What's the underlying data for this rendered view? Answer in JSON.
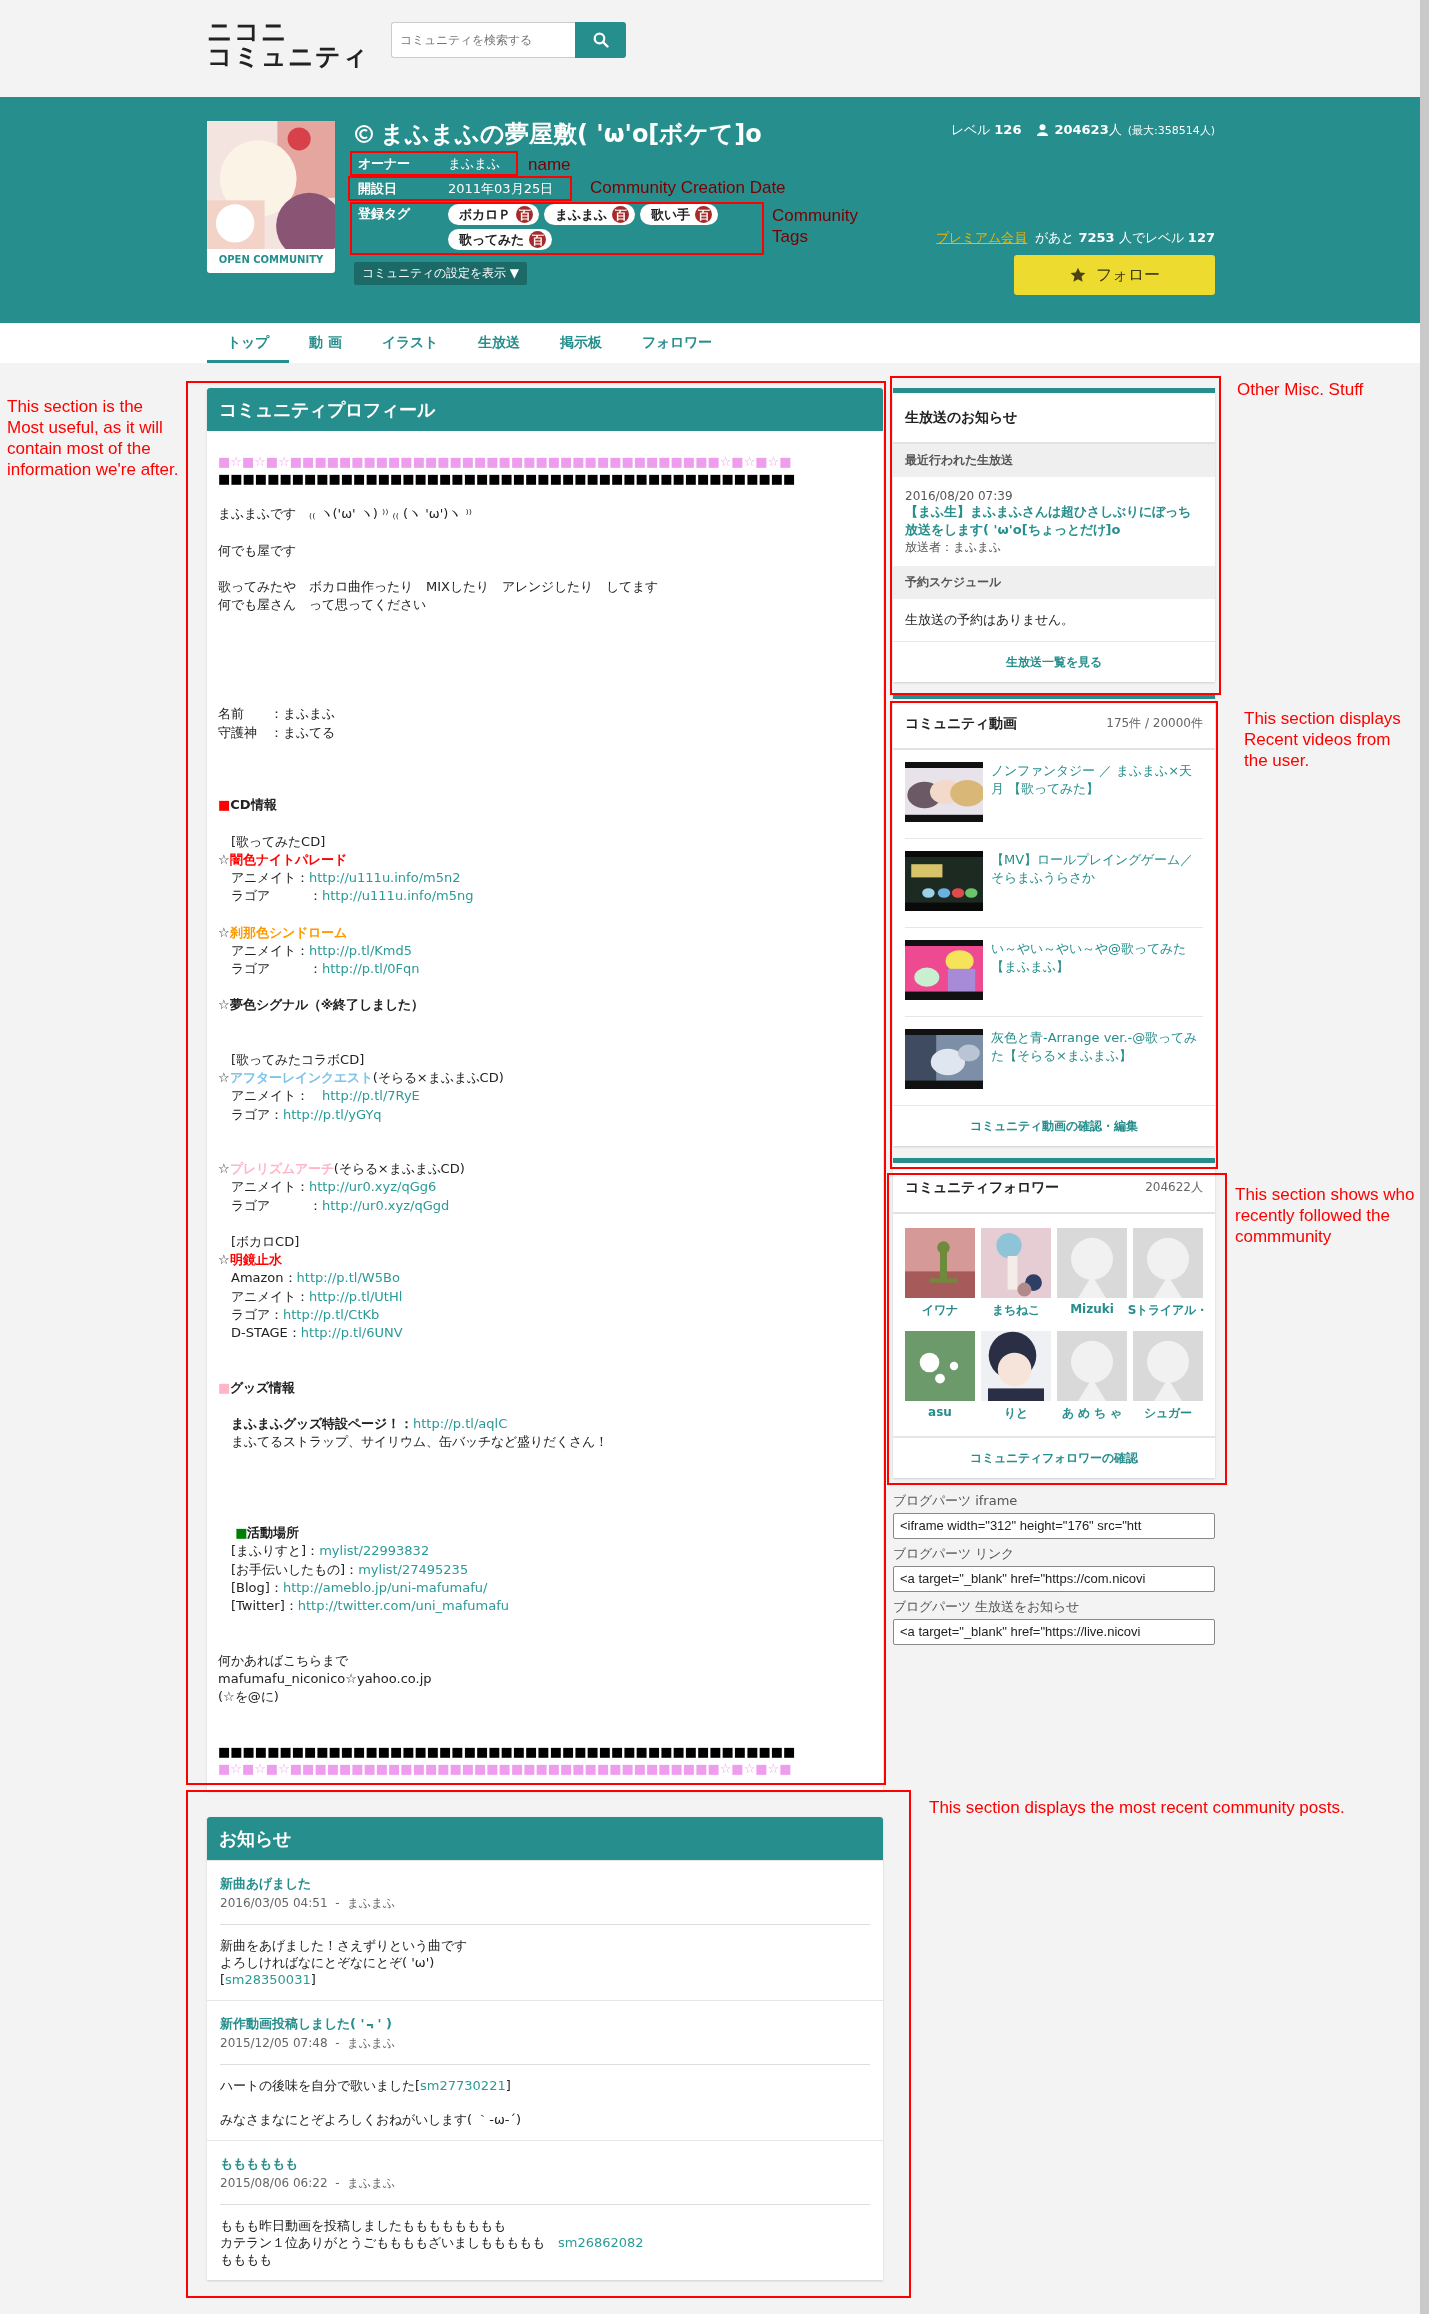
{
  "header": {
    "logo": [
      "ニコニ",
      "コミュニティ"
    ],
    "search": {
      "placeholder": "コミュニティを検索する"
    }
  },
  "community": {
    "title": "まふまふの夢屋敷( 'ω'o[ボケて]o",
    "avatar_label": "OPEN COMMUNITY",
    "info": [
      {
        "kind": "text",
        "label": "オーナー",
        "value": "まふまふ"
      },
      {
        "kind": "text",
        "label": "開設日",
        "value": "2011年03月25日"
      },
      {
        "kind": "tags",
        "label": "登録タグ",
        "tags": [
          {
            "name": "ボカロＰ",
            "badge": "百"
          },
          {
            "name": "まふまふ",
            "badge": "百"
          },
          {
            "name": "歌い手",
            "badge": "百"
          },
          {
            "name": "歌ってみた",
            "badge": "百"
          }
        ]
      }
    ],
    "settings_button": "コミュニティの設定を表示 ▼",
    "level": "レベル **126**",
    "members": "**204623**人",
    "members_max": "(最大:358514人)",
    "premium_link": "プレミアム会員",
    "premium_text": "があと **7253** 人でレベル **127**",
    "follow_button": "フォロー"
  },
  "tabs": [
    {
      "label": "トップ",
      "selected": true
    },
    {
      "label": "動 画",
      "selected": false
    },
    {
      "label": "イラスト",
      "selected": false
    },
    {
      "label": "生放送",
      "selected": false
    },
    {
      "label": "掲示板",
      "selected": false
    },
    {
      "label": "フォロワー",
      "selected": false
    }
  ],
  "profile": {
    "title": "コミュニティプロフィール",
    "lines": [
      {
        "kind": "bar",
        "text": "■☆■☆■☆■■■■■■■■■■■■■■■■■■■■■■■■■■■■■■■■■■■☆■☆■☆■",
        "color": "#ee9cee"
      },
      {
        "kind": "bar",
        "text": "■■■■■■■■■■■■■■■■■■■■■■■■■■■■■■■■■■■■■■■■■■■■■■■",
        "color": "#000000"
      },
      {
        "kind": "blank"
      },
      {
        "kind": "line",
        "parts": [
          {
            "kind": "text",
            "text": "まふまふです　₍₍ ヽ('ω' ヽ) ⁾⁾ ₍₍ (ヽ 'ω')ヽ ⁾⁾"
          }
        ]
      },
      {
        "kind": "blank"
      },
      {
        "kind": "line",
        "parts": [
          {
            "kind": "text",
            "text": "何でも屋です"
          }
        ]
      },
      {
        "kind": "blank"
      },
      {
        "kind": "line",
        "parts": [
          {
            "kind": "text",
            "text": "歌ってみたや　ボカロ曲作ったり　MIXしたり　アレンジしたり　してます"
          }
        ]
      },
      {
        "kind": "line",
        "parts": [
          {
            "kind": "text",
            "text": "何でも屋さん　って思ってください"
          }
        ]
      },
      {
        "kind": "blank"
      },
      {
        "kind": "blank"
      },
      {
        "kind": "blank"
      },
      {
        "kind": "blank"
      },
      {
        "kind": "blank"
      },
      {
        "kind": "line",
        "parts": [
          {
            "kind": "text",
            "text": "名前　　：まふまふ"
          }
        ]
      },
      {
        "kind": "line",
        "parts": [
          {
            "kind": "text",
            "text": "守護神　：まふてる"
          }
        ]
      },
      {
        "kind": "blank"
      },
      {
        "kind": "blank"
      },
      {
        "kind": "blank"
      },
      {
        "kind": "line",
        "parts": [
          {
            "kind": "mark",
            "text": "■",
            "color": "#ff0000"
          },
          {
            "kind": "strong",
            "text": "CD情報"
          }
        ]
      },
      {
        "kind": "blank"
      },
      {
        "kind": "line",
        "parts": [
          {
            "kind": "text",
            "text": "　[歌ってみたCD]"
          }
        ]
      },
      {
        "kind": "line",
        "parts": [
          {
            "kind": "text",
            "text": "☆"
          },
          {
            "kind": "title",
            "text": "闇色ナイトパレード",
            "color": "#ff0000"
          }
        ]
      },
      {
        "kind": "line",
        "parts": [
          {
            "kind": "text",
            "text": "　アニメイト："
          },
          {
            "kind": "link",
            "text": "http://u111u.info/m5n2"
          }
        ]
      },
      {
        "kind": "line",
        "parts": [
          {
            "kind": "text",
            "text": "　ラゴア　　　："
          },
          {
            "kind": "link",
            "text": "http://u111u.info/m5ng"
          }
        ]
      },
      {
        "kind": "blank"
      },
      {
        "kind": "line",
        "parts": [
          {
            "kind": "text",
            "text": "☆"
          },
          {
            "kind": "title",
            "text": "刹那色シンドローム",
            "color": "#ff9900"
          }
        ]
      },
      {
        "kind": "line",
        "parts": [
          {
            "kind": "text",
            "text": "　アニメイト："
          },
          {
            "kind": "link",
            "text": "http://p.tl/Kmd5"
          }
        ]
      },
      {
        "kind": "line",
        "parts": [
          {
            "kind": "text",
            "text": "　ラゴア　　　："
          },
          {
            "kind": "link",
            "text": "http://p.tl/0Fqn"
          }
        ]
      },
      {
        "kind": "blank"
      },
      {
        "kind": "line",
        "parts": [
          {
            "kind": "strong",
            "text": "☆夢色シグナル（※終了しました）"
          }
        ]
      },
      {
        "kind": "blank"
      },
      {
        "kind": "blank"
      },
      {
        "kind": "line",
        "parts": [
          {
            "kind": "text",
            "text": "　[歌ってみたコラボCD]"
          }
        ]
      },
      {
        "kind": "line",
        "parts": [
          {
            "kind": "text",
            "text": "☆"
          },
          {
            "kind": "title",
            "text": "アフターレインクエスト",
            "color": "#7ec4e6"
          },
          {
            "kind": "text",
            "text": "(そらる×まふまふCD)"
          }
        ]
      },
      {
        "kind": "line",
        "parts": [
          {
            "kind": "text",
            "text": "　アニメイト：　"
          },
          {
            "kind": "link",
            "text": "http://p.tl/7RyE"
          }
        ]
      },
      {
        "kind": "line",
        "parts": [
          {
            "kind": "text",
            "text": "　ラゴア："
          },
          {
            "kind": "link",
            "text": "http://p.tl/yGYq"
          }
        ]
      },
      {
        "kind": "blank"
      },
      {
        "kind": "blank"
      },
      {
        "kind": "line",
        "parts": [
          {
            "kind": "text",
            "text": "☆"
          },
          {
            "kind": "title",
            "text": "プレリズムアーチ",
            "color": "#ffb6c8"
          },
          {
            "kind": "text",
            "text": "(そらる×まふまふCD)"
          }
        ]
      },
      {
        "kind": "line",
        "parts": [
          {
            "kind": "text",
            "text": "　アニメイト："
          },
          {
            "kind": "link",
            "text": "http://ur0.xyz/qGg6"
          }
        ]
      },
      {
        "kind": "line",
        "parts": [
          {
            "kind": "text",
            "text": "　ラゴア　　　："
          },
          {
            "kind": "link",
            "text": "http://ur0.xyz/qGgd"
          }
        ]
      },
      {
        "kind": "blank"
      },
      {
        "kind": "line",
        "parts": [
          {
            "kind": "text",
            "text": "　[ボカロCD]"
          }
        ]
      },
      {
        "kind": "line",
        "parts": [
          {
            "kind": "text",
            "text": "☆"
          },
          {
            "kind": "title",
            "text": "明鏡止水",
            "color": "#ff0000"
          }
        ]
      },
      {
        "kind": "line",
        "parts": [
          {
            "kind": "text",
            "text": "　Amazon："
          },
          {
            "kind": "link",
            "text": "http://p.tl/W5Bo"
          }
        ]
      },
      {
        "kind": "line",
        "parts": [
          {
            "kind": "text",
            "text": "　アニメイト："
          },
          {
            "kind": "link",
            "text": "http://p.tl/UtHl"
          }
        ]
      },
      {
        "kind": "line",
        "parts": [
          {
            "kind": "text",
            "text": "　ラゴア："
          },
          {
            "kind": "link",
            "text": "http://p.tl/CtKb"
          }
        ]
      },
      {
        "kind": "line",
        "parts": [
          {
            "kind": "text",
            "text": "　D-STAGE："
          },
          {
            "kind": "link",
            "text": "http://p.tl/6UNV"
          }
        ]
      },
      {
        "kind": "blank"
      },
      {
        "kind": "blank"
      },
      {
        "kind": "line",
        "parts": [
          {
            "kind": "mark",
            "text": "■",
            "color": "#ffb6c8"
          },
          {
            "kind": "strong",
            "text": "グッズ情報"
          }
        ]
      },
      {
        "kind": "blank"
      },
      {
        "kind": "line",
        "parts": [
          {
            "kind": "strong",
            "text": "　まふまふグッズ特設ページ！："
          },
          {
            "kind": "link",
            "text": "http://p.tl/aqlC"
          }
        ]
      },
      {
        "kind": "line",
        "parts": [
          {
            "kind": "text",
            "text": "　まふてるストラップ、サイリウム、缶バッチなど盛りだくさん！"
          }
        ]
      },
      {
        "kind": "blank"
      },
      {
        "kind": "blank"
      },
      {
        "kind": "blank"
      },
      {
        "kind": "blank"
      },
      {
        "kind": "line",
        "parts": [
          {
            "kind": "mark",
            "text": "　 ■",
            "color": "#008000"
          },
          {
            "kind": "strong",
            "text": "活動場所"
          }
        ]
      },
      {
        "kind": "line",
        "parts": [
          {
            "kind": "text",
            "text": "　[まふりすと]："
          },
          {
            "kind": "link",
            "text": "mylist/22993832"
          }
        ]
      },
      {
        "kind": "line",
        "parts": [
          {
            "kind": "text",
            "text": "　[お手伝いしたもの]："
          },
          {
            "kind": "link",
            "text": "mylist/27495235"
          }
        ]
      },
      {
        "kind": "line",
        "parts": [
          {
            "kind": "text",
            "text": "　[Blog]："
          },
          {
            "kind": "link",
            "text": "http://ameblo.jp/uni-mafumafu/"
          }
        ]
      },
      {
        "kind": "line",
        "parts": [
          {
            "kind": "text",
            "text": "　[Twitter]："
          },
          {
            "kind": "link",
            "text": "http://twitter.com/uni_mafumafu"
          }
        ]
      },
      {
        "kind": "blank"
      },
      {
        "kind": "blank"
      },
      {
        "kind": "line",
        "parts": [
          {
            "kind": "text",
            "text": "何かあればこちらまで"
          }
        ]
      },
      {
        "kind": "line",
        "parts": [
          {
            "kind": "text",
            "text": "mafumafu_niconico☆yahoo.co.jp"
          }
        ]
      },
      {
        "kind": "line",
        "parts": [
          {
            "kind": "text",
            "text": "(☆を@に)"
          }
        ]
      },
      {
        "kind": "blank"
      },
      {
        "kind": "blank"
      },
      {
        "kind": "bar",
        "text": "■■■■■■■■■■■■■■■■■■■■■■■■■■■■■■■■■■■■■■■■■■■■■■■",
        "color": "#000000"
      },
      {
        "kind": "bar",
        "text": "■☆■☆■☆■■■■■■■■■■■■■■■■■■■■■■■■■■■■■■■■■■■☆■☆■☆■",
        "color": "#ee9cee"
      }
    ]
  },
  "notices": {
    "title": "お知らせ",
    "posts": [
      {
        "title": "新曲あげました",
        "meta": "2016/03/05 04:51  -  まふまふ",
        "lines": [
          {
            "kind": "line",
            "parts": [
              {
                "kind": "text",
                "text": "新曲をあげました！さえずりという曲です"
              }
            ]
          },
          {
            "kind": "line",
            "parts": [
              {
                "kind": "text",
                "text": "よろしければなにとぞなにとぞ( 'ω')"
              }
            ]
          },
          {
            "kind": "line",
            "parts": [
              {
                "kind": "text",
                "text": "["
              },
              {
                "kind": "link",
                "text": "sm28350031"
              },
              {
                "kind": "text",
                "text": "]"
              }
            ]
          }
        ]
      },
      {
        "title": "新作動画投稿しました( '﹃' )",
        "meta": "2015/12/05 07:48  -  まふまふ",
        "lines": [
          {
            "kind": "line",
            "parts": [
              {
                "kind": "text",
                "text": "ハートの後味を自分で歌いました["
              },
              {
                "kind": "link",
                "text": "sm27730221"
              },
              {
                "kind": "text",
                "text": "]"
              }
            ]
          },
          {
            "kind": "blank"
          },
          {
            "kind": "line",
            "parts": [
              {
                "kind": "text",
                "text": "みなさまなにとぞよろしくおねがいします( ｀-ω-´)"
              }
            ]
          }
        ]
      },
      {
        "title": "もももももも",
        "meta": "2015/08/06 06:22  -  まふまふ",
        "lines": [
          {
            "kind": "line",
            "parts": [
              {
                "kind": "text",
                "text": "ももも昨日動画を投稿しましたもももももももも"
              }
            ]
          },
          {
            "kind": "line",
            "parts": [
              {
                "kind": "text",
                "text": "カテラン１位ありがとうごももももざいましももももも　"
              },
              {
                "kind": "link",
                "text": "sm26862082"
              }
            ]
          },
          {
            "kind": "line",
            "parts": [
              {
                "kind": "text",
                "text": "もももも"
              }
            ]
          }
        ]
      }
    ]
  },
  "live": {
    "title": "生放送のお知らせ",
    "recent_heading": "最近行われた生放送",
    "recent": {
      "date": "2016/08/20 07:39",
      "title": "【まふ生】まふまふさんは超ひさしぶりにぼっち放送をします( 'ω'o[ちょっとだけ]o",
      "broadcaster": "放送者：まふまふ"
    },
    "schedule_heading": "予約スケジュール",
    "schedule_empty": "生放送の予約はありません。",
    "footer_link": "生放送一覧を見る"
  },
  "videos": {
    "title": "コミュニティ動画",
    "count": "175件 / 20000件",
    "items": [
      {
        "title": "ノンファンタジー ／ まふまふ×天月 【歌ってみた】"
      },
      {
        "title": "【MV】ロールプレイングゲーム／そらまふうらさか"
      },
      {
        "title": "い～やい～やい～や@歌ってみた【まふまふ】"
      },
      {
        "title": "灰色と青-Arrange ver.-@歌ってみた【そらる×まふまふ】"
      }
    ],
    "footer_link": "コミュニティ動画の確認・編集"
  },
  "followers": {
    "title": "コミュニティフォロワー",
    "count": "204622人",
    "items": [
      {
        "name": "イワナ",
        "kind": "picture"
      },
      {
        "name": "まちねこ",
        "kind": "picture"
      },
      {
        "name": "Mizuki",
        "kind": "default"
      },
      {
        "name": "Sトライアル・",
        "kind": "default"
      },
      {
        "name": "asu",
        "kind": "picture"
      },
      {
        "name": "りと",
        "kind": "picture"
      },
      {
        "name": "あ め ち ゃ",
        "kind": "default"
      },
      {
        "name": "シュガー",
        "kind": "default"
      }
    ],
    "footer_link": "コミュニティフォロワーの確認"
  },
  "blog_parts": [
    {
      "label": "ブログパーツ iframe",
      "value": "<iframe width=\"312\" height=\"176\" src=\"htt"
    },
    {
      "label": "ブログパーツ リンク",
      "value": "<a target=\"_blank\" href=\"https://com.nicovi"
    },
    {
      "label": "ブログパーツ 生放送をお知らせ",
      "value": "<a target=\"_blank\" href=\"https://live.nicovi"
    }
  ],
  "annotations": [
    {
      "note": "name"
    },
    {
      "note": "Community Creation Date"
    },
    {
      "note": "Community Tags"
    },
    {
      "note": "This section is the Most useful, as it will contain most of the information we're after."
    },
    {
      "note": "Other Misc. Stuff"
    },
    {
      "note": "This section displays Recent videos from the user."
    },
    {
      "note": "This section shows who recently followed the commmunity"
    },
    {
      "note": "This section displays the most recent community posts."
    }
  ]
}
